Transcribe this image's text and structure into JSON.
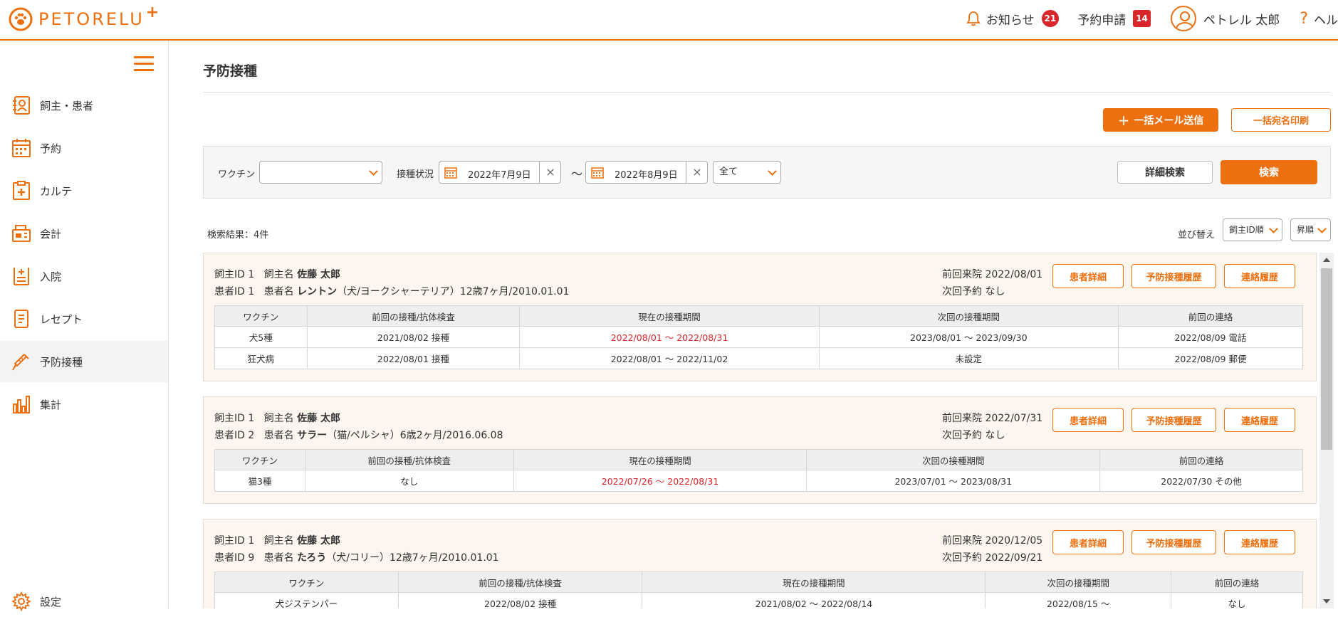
{
  "header": {
    "logo_text": "PETORELU",
    "logo_plus": "+",
    "notice_label": "お知らせ",
    "notice_count": "21",
    "request_label": "予約申請",
    "request_count": "14",
    "user_name": "ペトレル 太郎",
    "help_label": "ヘル"
  },
  "sidebar": {
    "items": [
      {
        "label": "飼主・患者",
        "icon": "owner-patient-icon"
      },
      {
        "label": "予約",
        "icon": "calendar-icon"
      },
      {
        "label": "カルテ",
        "icon": "medical-record-icon"
      },
      {
        "label": "会計",
        "icon": "register-icon"
      },
      {
        "label": "入院",
        "icon": "hospitalization-icon"
      },
      {
        "label": "レセプト",
        "icon": "receipt-icon"
      },
      {
        "label": "予防接種",
        "icon": "syringe-icon"
      },
      {
        "label": "集計",
        "icon": "bar-chart-icon"
      }
    ],
    "settings_label": "設定",
    "active_index": 6
  },
  "page": {
    "title": "予防接種",
    "bulk_mail_label": "一括メール送信",
    "bulk_print_label": "一括宛名印刷"
  },
  "filters": {
    "vaccine_label": "ワクチン",
    "vaccine_value": "",
    "status_label": "接種状況",
    "date_from": "2022年7月9日",
    "range_sep": "〜",
    "date_to": "2022年8月9日",
    "all_value": "全て",
    "detail_search_label": "詳細検索",
    "search_label": "検索"
  },
  "results": {
    "count_label": "検索結果：4件",
    "sort_label": "並び替え",
    "sort_field": "飼主ID順",
    "sort_order": "昇順"
  },
  "table_headers": [
    "ワクチン",
    "前回の接種/抗体検査",
    "現在の接種期間",
    "次回の接種期間",
    "前回の連絡"
  ],
  "card_buttons": {
    "patient_detail": "患者詳細",
    "vaccination_history": "予防接種履歴",
    "contact_history": "連絡履歴"
  },
  "cards": [
    {
      "owner_id": "飼主ID 1",
      "owner_name_label": "飼主名",
      "owner_name": "佐藤 太郎",
      "patient_id": "患者ID 1",
      "patient_name_label": "患者名",
      "patient_name": "レントン",
      "patient_info": "（犬/ヨークシャーテリア）12歳7ヶ月/2010.01.01",
      "last_visit": "前回来院 2022/08/01",
      "next_reservation": "次回予約 なし",
      "rows": [
        [
          "犬5種",
          "2021/08/02 接種",
          "2022/08/01 〜 2022/08/31",
          "2023/08/01 〜 2023/09/30",
          "2022/08/09 電話"
        ],
        [
          "狂犬病",
          "2022/08/01 接種",
          "2022/08/01 〜 2022/11/02",
          "未設定",
          "2022/08/09 郵便"
        ]
      ],
      "red_current": [
        true,
        false
      ]
    },
    {
      "owner_id": "飼主ID 1",
      "owner_name_label": "飼主名",
      "owner_name": "佐藤 太郎",
      "patient_id": "患者ID 2",
      "patient_name_label": "患者名",
      "patient_name": "サラー",
      "patient_info": "（猫/ペルシャ）6歳2ヶ月/2016.06.08",
      "last_visit": "前回来院 2022/07/31",
      "next_reservation": "次回予約 なし",
      "rows": [
        [
          "猫3種",
          "なし",
          "2022/07/26 〜 2022/08/31",
          "2023/07/01 〜 2023/08/31",
          "2022/07/30 その他"
        ]
      ],
      "red_current": [
        true
      ]
    },
    {
      "owner_id": "飼主ID 1",
      "owner_name_label": "飼主名",
      "owner_name": "佐藤 太郎",
      "patient_id": "患者ID 9",
      "patient_name_label": "患者名",
      "patient_name": "たろう",
      "patient_info": "（犬/コリー）12歳7ヶ月/2010.01.01",
      "last_visit": "前回来院 2020/12/05",
      "next_reservation": "次回予約 2022/09/21",
      "rows": [
        [
          "犬ジステンパー",
          "2022/08/02 接種",
          "2021/08/02 〜 2022/08/14",
          "2022/08/15 〜",
          "なし"
        ]
      ],
      "red_current": [
        false
      ]
    }
  ],
  "colors": {
    "accent": "#ee6f0e",
    "badge": "#d8262a",
    "card_bg": "#fdf6ef"
  }
}
